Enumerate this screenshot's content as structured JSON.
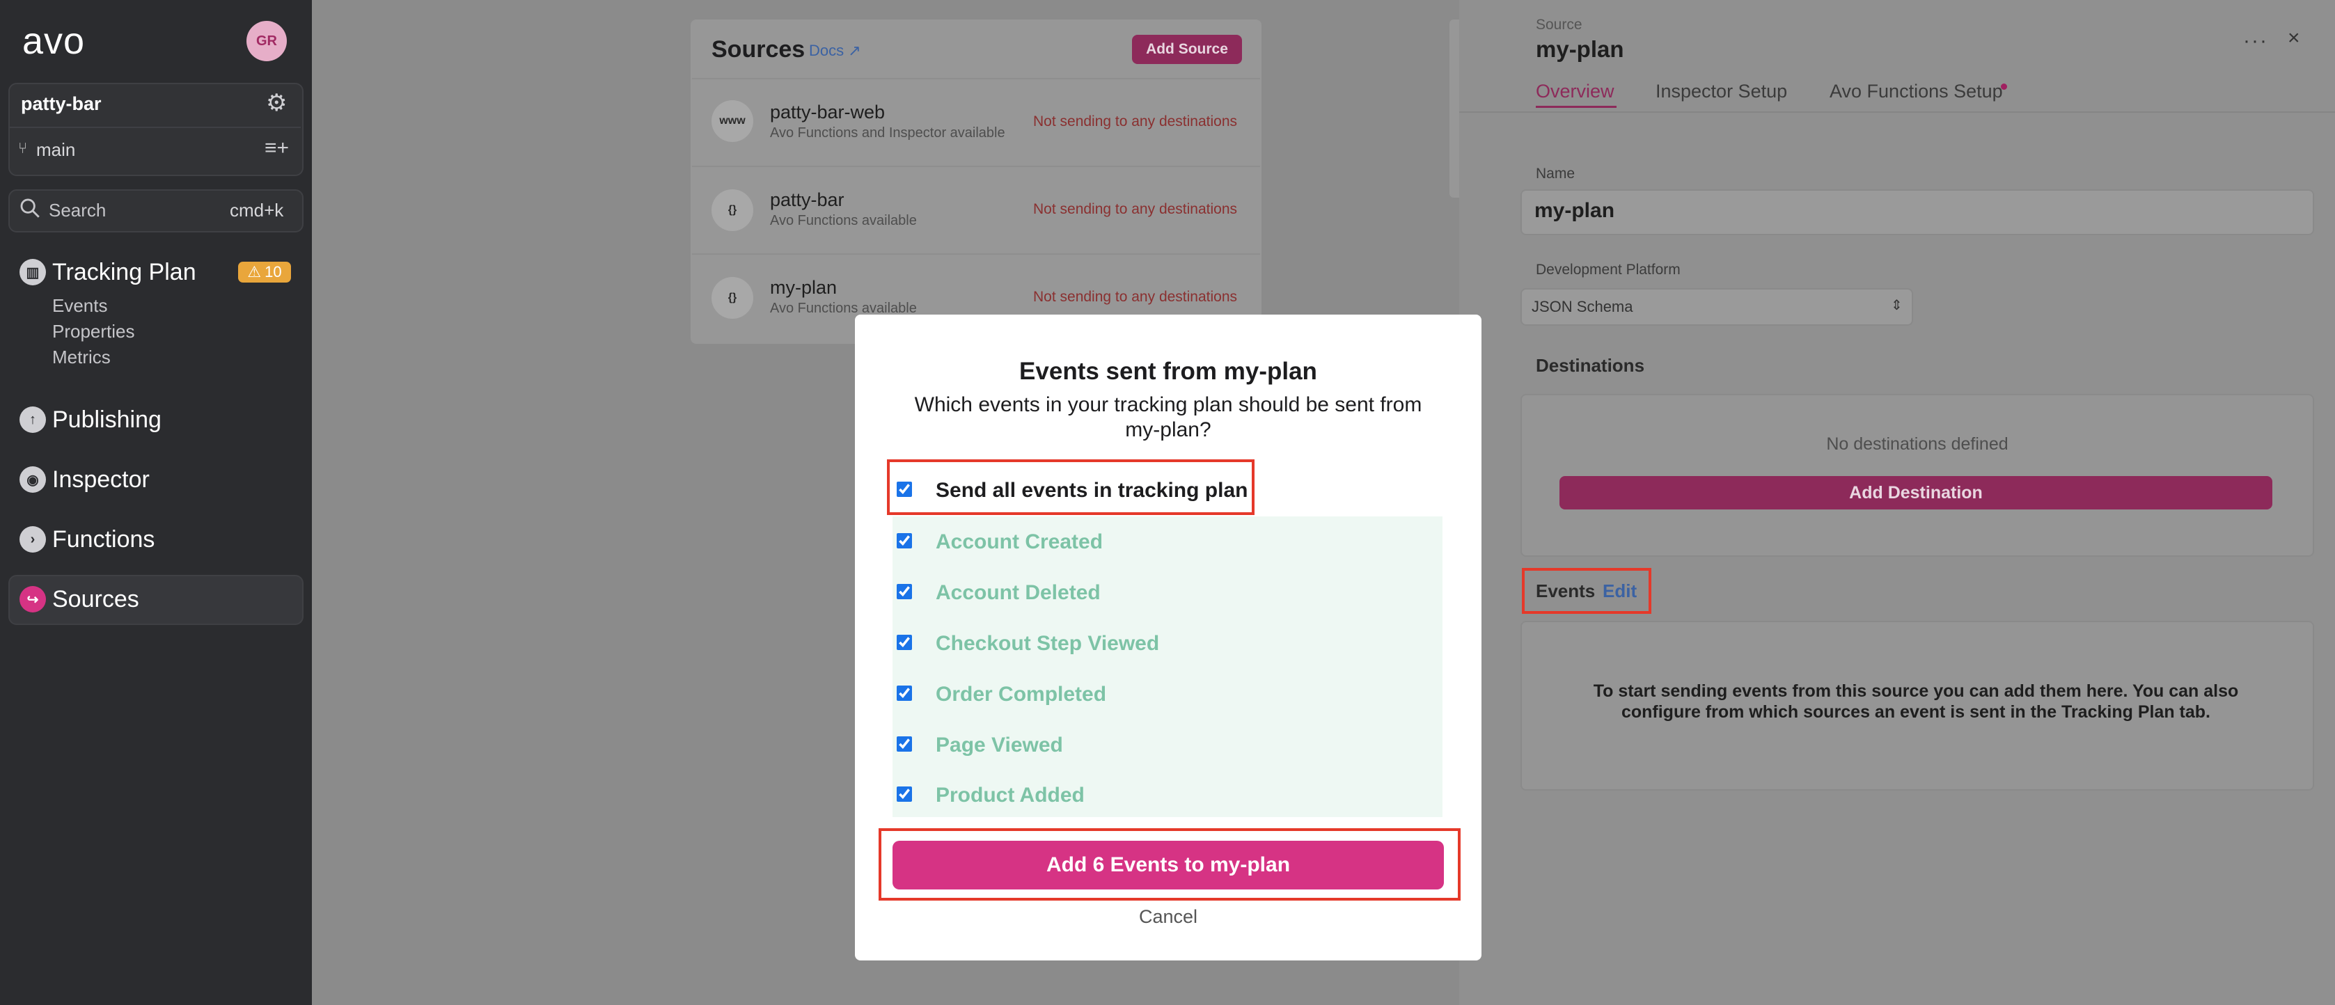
{
  "sidebar": {
    "logo": "avo",
    "avatar": "GR",
    "workspace": "patty-bar",
    "branch": "main",
    "search": {
      "label": "Search",
      "shortcut": "cmd+k"
    },
    "tracking_plan": {
      "label": "Tracking Plan",
      "badge": "10",
      "sub_items": [
        "Events",
        "Properties",
        "Metrics"
      ]
    },
    "nav": [
      {
        "label": "Publishing",
        "icon": "cloud-upload-icon"
      },
      {
        "label": "Inspector",
        "icon": "inspector-icon"
      },
      {
        "label": "Functions",
        "icon": "functions-icon"
      },
      {
        "label": "Sources",
        "icon": "sources-icon"
      }
    ]
  },
  "sources_panel": {
    "title": "Sources",
    "docs": "Docs ↗",
    "add_source": "Add Source",
    "items": [
      {
        "icon": "www",
        "name": "patty-bar-web",
        "desc": "Avo Functions and Inspector available",
        "status": "Not sending to any destinations"
      },
      {
        "icon": "{}",
        "name": "patty-bar",
        "desc": "Avo Functions available",
        "status": "Not sending to any destinations"
      },
      {
        "icon": "{}",
        "name": "my-plan",
        "desc": "Avo Functions available",
        "status": "Not sending to any destinations"
      }
    ]
  },
  "right_panel": {
    "kicker": "Source",
    "title": "my-plan",
    "more": "···",
    "close": "×",
    "tabs": [
      "Overview",
      "Inspector Setup",
      "Avo Functions Setup"
    ],
    "name_label": "Name",
    "name_value": "my-plan",
    "platform_label": "Development Platform",
    "platform_value": "JSON Schema",
    "destinations_heading": "Destinations",
    "destinations_empty": "No destinations defined",
    "add_destination": "Add Destination",
    "events_label": "Events",
    "events_edit": "Edit",
    "events_empty": "To start sending events from this source you can add them here. You can also configure from which sources an event is sent in the Tracking Plan tab."
  },
  "modal": {
    "title": "Events sent from my-plan",
    "subtitle": "Which events in your tracking plan should be sent from my-plan?",
    "send_all": "Send all events in tracking plan",
    "events": [
      "Account Created",
      "Account Deleted",
      "Checkout Step Viewed",
      "Order Completed",
      "Page Viewed",
      "Product Added"
    ],
    "add_button": "Add 6 Events to my-plan",
    "cancel": "Cancel"
  },
  "colors": {
    "brand": "#d63384",
    "highlight": "#e5392a",
    "event_text": "#7dc3a6"
  }
}
